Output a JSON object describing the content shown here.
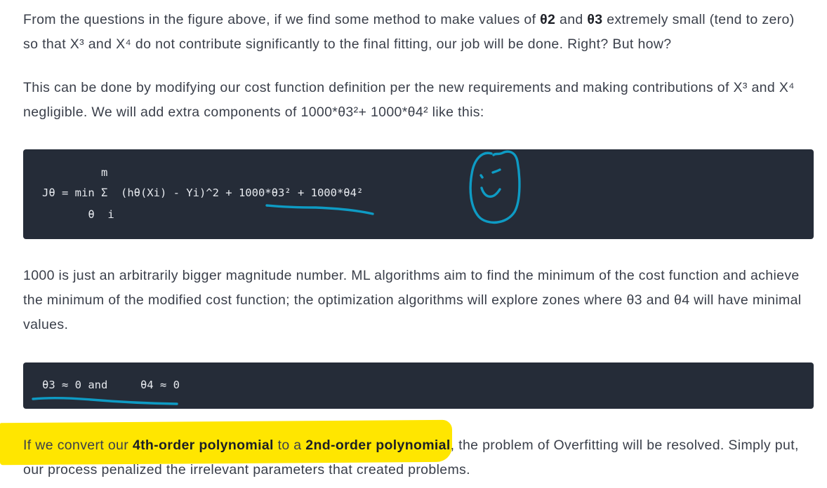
{
  "article": {
    "p1": {
      "t1": "From the questions in the figure above, if we find some method to make values of ",
      "b1": "θ2",
      "t2": " and ",
      "b2": "θ3",
      "t3": " extremely small (tend to zero) so that X³ and X⁴ do not contribute significantly to the final fitting, our job will be done. Right? But how?"
    },
    "p2": "This can be done by modifying our cost function definition per the new requirements and making contributions of X³ and X⁴ negligible. We will add extra components of 1000*θ3²+ 1000*θ4² like this:",
    "code1": {
      "line1": "         m",
      "line2_a": "Jθ = min Σ  (hθ(Xi) - Yi)^2 + ",
      "line2_b": "1000*θ3²",
      "line2_c": " + 1000*θ4²",
      "line3": "       θ  i"
    },
    "p3": "1000 is just an arbitrarily bigger magnitude number. ML algorithms aim to find the minimum of the cost function and achieve the minimum of the modified cost function; the optimization algorithms will explore zones where θ3 and θ4 will have minimal values.",
    "code2": {
      "line1": "θ3 ≈ 0 and     θ4 ≈ 0"
    },
    "p4": {
      "t1": "If we convert our ",
      "b1": "4th-order polynomial",
      "t2": " to a ",
      "b2": "2nd-order polynomial",
      "t3": ", the problem of Overfitting will be resolved. Simply put, our process penalized the irrelevant parameters that created problems."
    }
  },
  "annotations": {
    "ink_color": "#0e9bc4",
    "highlight_color": "#ffe600"
  }
}
